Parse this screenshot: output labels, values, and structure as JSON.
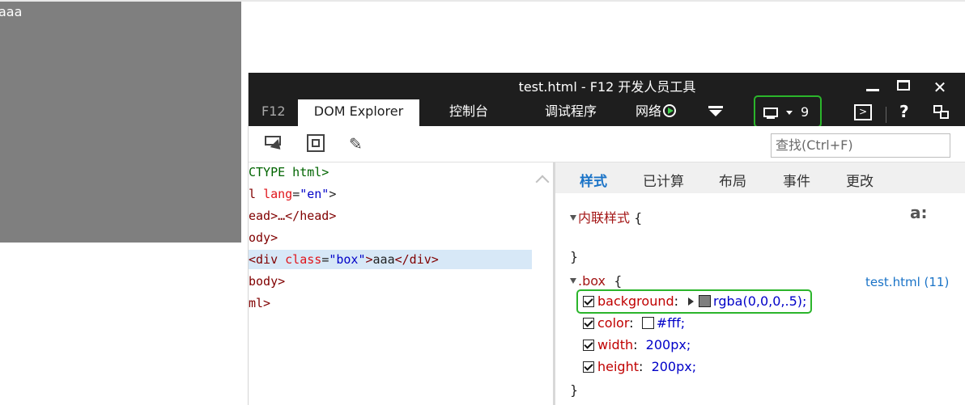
{
  "page": {
    "box_text": "aaa"
  },
  "window": {
    "title": "test.html - F12 开发人员工具"
  },
  "tabs": {
    "f12": "F12",
    "dom_explorer": "DOM Explorer",
    "console": "控制台",
    "debugger": "调试程序",
    "network": "网络"
  },
  "emulation": {
    "count": "9"
  },
  "toolbar": {
    "search_placeholder": "查找(Ctrl+F)"
  },
  "dom_tree": {
    "line1": {
      "doctype": "CTYPE html>"
    },
    "line2": {
      "tag_start": "l ",
      "attr": "lang",
      "eq": "=",
      "val": "\"en\"",
      "end": ">"
    },
    "line3": {
      "text": "ead>…</head>"
    },
    "line4": {
      "text": "ody>"
    },
    "line5": {
      "open": "<div ",
      "attr": "class",
      "eq": "=",
      "val": "\"box\"",
      "gt": ">",
      "text": "aaa",
      "close": "</div>"
    },
    "line6": {
      "text": "body>"
    },
    "line7": {
      "text": "ml>"
    }
  },
  "styles_tabs": {
    "styles": "样式",
    "computed": "已计算",
    "layout": "布局",
    "events": "事件",
    "changes": "更改"
  },
  "styles": {
    "inline_label": "内联样式",
    "open_brace": "{",
    "close_brace": "}",
    "pseudo_label": "a:",
    "box_selector": ".box",
    "source": "test.html (11)",
    "properties": [
      {
        "name": "background",
        "value": "rgba(0,0,0,.5);",
        "swatch": "#7f7f7f"
      },
      {
        "name": "color",
        "value": "#fff;",
        "swatch": "#ffffff"
      },
      {
        "name": "width",
        "value": "200px;"
      },
      {
        "name": "height",
        "value": "200px;"
      }
    ]
  },
  "colors": {
    "highlight_green": "#2bb52b",
    "titlebar": "#1e1e1e",
    "box_gray": "#7f7f7f",
    "selected_row": "#d7e8f7",
    "link_blue": "#1a73c7"
  }
}
